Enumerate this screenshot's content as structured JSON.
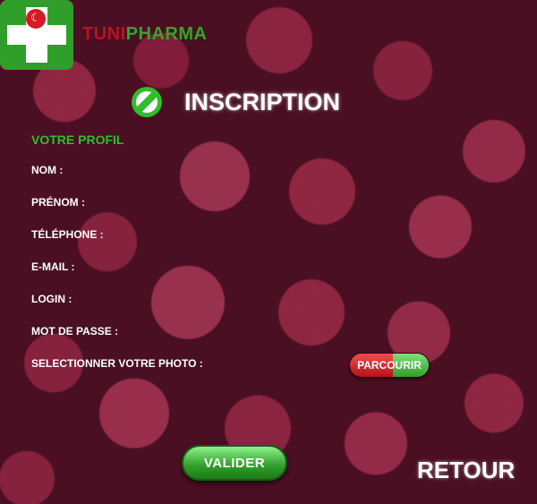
{
  "brand": {
    "part1": "TUNI",
    "part2": "PHARMA"
  },
  "logo": {
    "icon": "pharmacy-cross-icon"
  },
  "header": {
    "title": "INSCRIPTION",
    "icon": "pill-capsule-icon"
  },
  "form": {
    "section_label": "VOTRE PROFIL",
    "fields": [
      {
        "label": "NOM :"
      },
      {
        "label": "PRÉNOM :"
      },
      {
        "label": "TÉLÉPHONE :"
      },
      {
        "label": "E-MAIL :"
      },
      {
        "label": "LOGIN :"
      },
      {
        "label": "MOT DE PASSE :"
      },
      {
        "label": "SELECTIONNER VOTRE PHOTO :"
      }
    ],
    "browse_label": "PARCOURIR"
  },
  "actions": {
    "validate_label": "VALIDER",
    "back_label": "RETOUR"
  },
  "colors": {
    "green": "#2fbf2a",
    "red": "#c01020",
    "background": "#4a0f22"
  }
}
